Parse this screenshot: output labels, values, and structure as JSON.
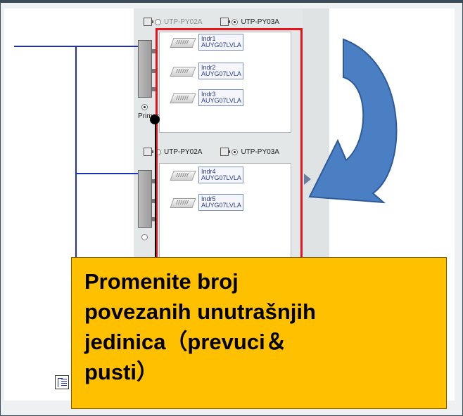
{
  "systems": [
    {
      "option_a": "UTP-PY02A",
      "option_b": "UTP-PY03A",
      "selected": "UTP-PY03A",
      "role_label": "Primary",
      "units": [
        {
          "name": "Indr1",
          "model": "AUYG07LVLA"
        },
        {
          "name": "Indr2",
          "model": "AUYG07LVLA"
        },
        {
          "name": "Indr3",
          "model": "AUYG07LVLA"
        }
      ]
    },
    {
      "option_a": "UTP-PY02A",
      "option_b": "UTP-PY03A",
      "selected": "UTP-PY03A",
      "units": [
        {
          "name": "Indr4",
          "model": "AUYG07LVLA"
        },
        {
          "name": "Indr5",
          "model": "AUYG07LVLA"
        }
      ]
    }
  ],
  "callout": {
    "line1": "Promenite broj",
    "line2": "povezanih unutrašnjih",
    "line3": "jedinica（prevuci＆",
    "line4": "pusti）"
  },
  "colors": {
    "highlight": "#e8141c",
    "callout_bg": "#ffc000",
    "wiring": "#1f2fb8",
    "arrow": "#4a7fc4"
  },
  "icons": [
    "outdoor-unit-icon",
    "indoor-cassette-icon",
    "curved-arrow-icon",
    "tree-view-icon",
    "play-icon"
  ]
}
